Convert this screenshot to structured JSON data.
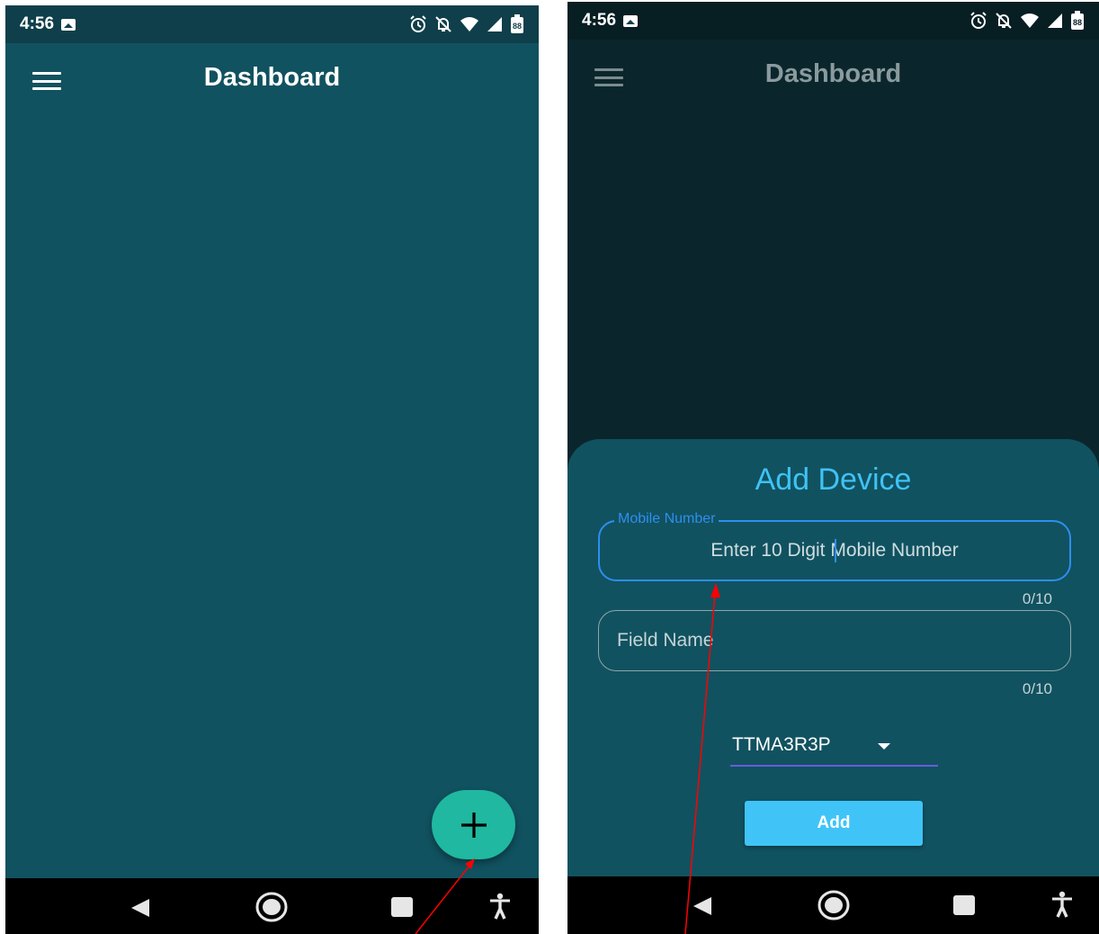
{
  "left_screen": {
    "status_bar": {
      "time": "4:56",
      "battery": "88"
    },
    "app_bar": {
      "title": "Dashboard",
      "menu_icon": "hamburger-menu-icon"
    },
    "fab": {
      "icon": "plus-icon"
    }
  },
  "right_screen": {
    "status_bar": {
      "time": "4:56",
      "battery": "88"
    },
    "app_bar": {
      "title": "Dashboard",
      "menu_icon": "hamburger-menu-icon"
    },
    "add_device_sheet": {
      "title": "Add Device",
      "mobile_number": {
        "label": "Mobile Number",
        "hint": "Enter 10 Digit Mobile Number",
        "counter": "0/10"
      },
      "field_name": {
        "placeholder": "Field Name",
        "counter": "0/10"
      },
      "device_dropdown": {
        "selected": "TTMA3R3P"
      },
      "add_button_label": "Add"
    }
  },
  "colors": {
    "background": "#115260",
    "status_bar": "#0f3f4a",
    "fab": "#20b8a0",
    "accent_blue": "#2e8ef0",
    "title_blue": "#3fc2f5",
    "add_button": "#40c4f8",
    "dropdown_underline": "#6a5ae0",
    "annotation_arrow": "#ff0000"
  }
}
